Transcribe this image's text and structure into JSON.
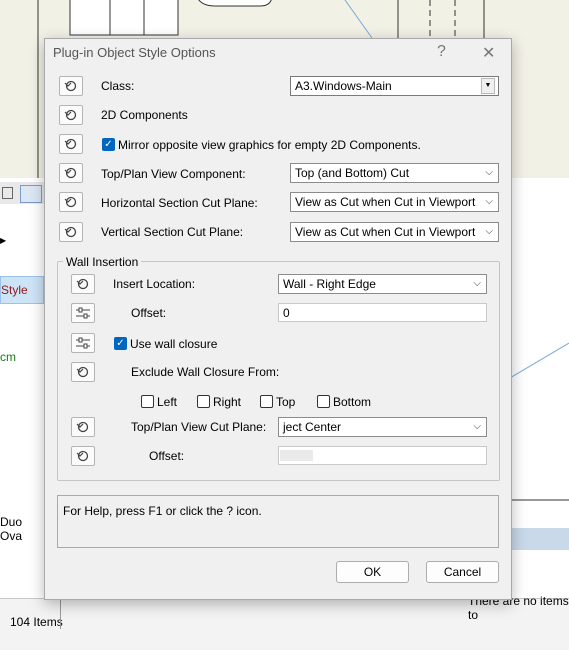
{
  "background": {
    "left_labels": [
      "Style",
      "cm",
      "Duo Ova"
    ],
    "status_items": "104 Items",
    "no_items_text": "There are no items to"
  },
  "dialog": {
    "title": "Plug-in Object Style Options",
    "help_glyph": "?",
    "close_glyph": "✕",
    "class_label": "Class:",
    "class_value": "A3.Windows-Main",
    "components_label": "2D Components",
    "mirror_label": "Mirror opposite view graphics for empty 2D Components.",
    "mirror_checked": true,
    "top_plan_label": "Top/Plan View Component:",
    "top_plan_value": "Top (and Bottom) Cut",
    "horiz_label": "Horizontal Section Cut Plane:",
    "horiz_value": "View as Cut when Cut in Viewport",
    "vert_label": "Vertical Section Cut Plane:",
    "vert_value": "View as Cut when Cut in Viewport",
    "wall_group": {
      "title": "Wall Insertion",
      "insert_location_label": "Insert Location:",
      "insert_location_value": "Wall - Right Edge",
      "offset_label": "Offset:",
      "offset_value": "0",
      "closure_label": "Use wall closure",
      "closure_checked": true,
      "exclude_label": "Exclude Wall Closure From:",
      "exclude_left": "Left",
      "exclude_right": "Right",
      "exclude_top": "Top",
      "exclude_bottom": "Bottom",
      "cut_plane_label": "Top/Plan View Cut Plane:",
      "cut_plane_value": "ject Center",
      "offset2_label": "Offset:",
      "offset2_value": ""
    },
    "help_text": "For Help, press F1 or click the ? icon.",
    "ok_label": "OK",
    "cancel_label": "Cancel"
  }
}
